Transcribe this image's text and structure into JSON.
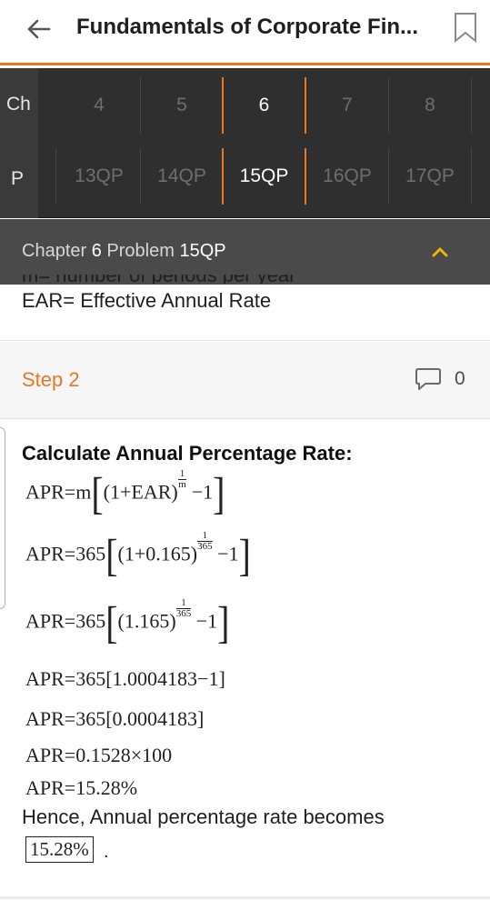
{
  "header": {
    "title": "Fundamentals of Corporate Fin...",
    "accent_color": "#e87722",
    "back_icon": "arrow-left-icon",
    "bookmark_icon": "bookmark-icon"
  },
  "selector": {
    "chapter_label": "Ch",
    "problem_label": "P",
    "chapters": [
      "4",
      "5",
      "6",
      "7",
      "8"
    ],
    "selected_chapter": "6",
    "problems": [
      "13QP",
      "14QP",
      "15QP",
      "16QP",
      "17QP"
    ],
    "selected_problem": "15QP"
  },
  "chapter_bar": {
    "prefix": "Chapter",
    "chapter": "6",
    "middle": "Problem",
    "problem": "15QP",
    "chevron_icon": "chevron-up-icon"
  },
  "content": {
    "prev_line_cut": "m= number of periods per year",
    "prev_line": "EAR= Effective Annual Rate",
    "step": {
      "label": "Step 2",
      "comment_count": "0",
      "comment_icon": "comment-icon",
      "heading": "Calculate Annual Percentage Rate:",
      "eq1_left": "APR=m",
      "eq1_inner": "(1+EAR)",
      "eq1_exp_num": "1",
      "eq1_exp_den": "m",
      "eq1_tail": "−1",
      "eq2_left": "APR=365",
      "eq2_inner": "(1+0.165)",
      "eq2_exp_num": "1",
      "eq2_exp_den": "365",
      "eq2_tail": "−1",
      "eq3_left": "APR=365",
      "eq3_inner": "(1.165)",
      "eq3_exp_num": "1",
      "eq3_exp_den": "365",
      "eq3_tail": "−1",
      "eq4": "APR=365[1.0004183−1]",
      "eq5": "APR=365[0.0004183]",
      "eq6": "APR=0.1528×100",
      "eq7": "APR=15.28%",
      "conclusion": "Hence, Annual percentage rate becomes",
      "answer": "15.28%",
      "period": "."
    }
  }
}
